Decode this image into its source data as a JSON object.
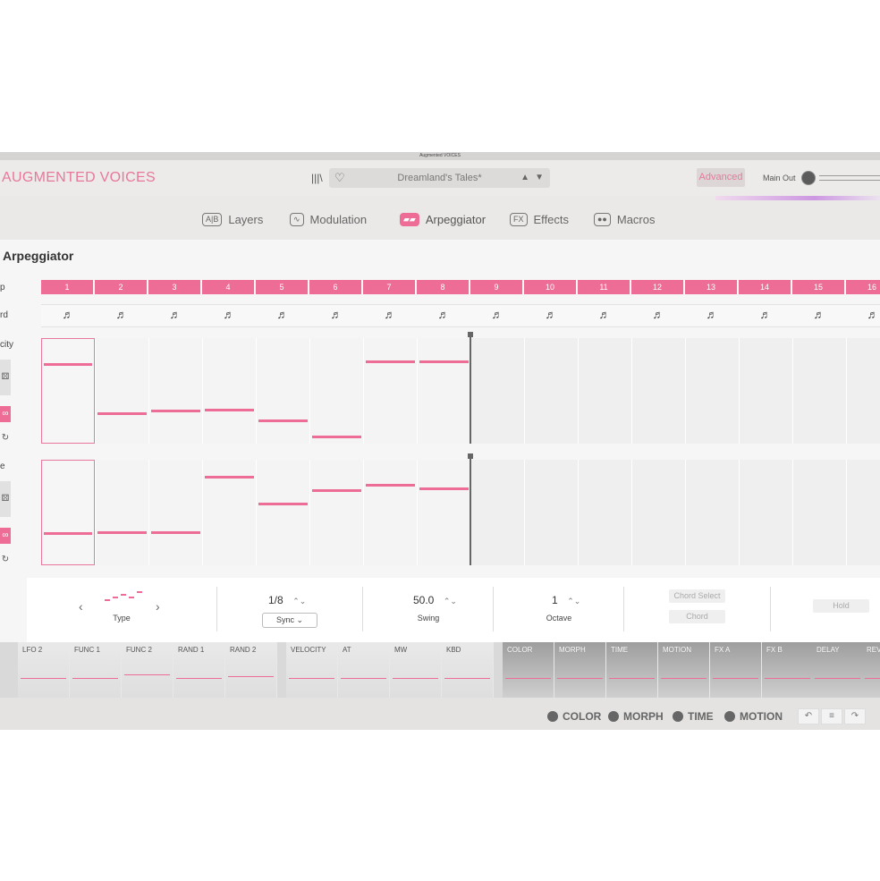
{
  "window_title": "Augmented VOICES",
  "header": {
    "brand": "AUGMENTED VOICES",
    "library_icon": "library-icon",
    "preset_name": "Dreamland's Tales*",
    "prev_icon": "▲",
    "next_icon": "▼",
    "advanced_label": "Advanced",
    "main_out_label": "Main Out"
  },
  "tabs": [
    {
      "badge": "A|B",
      "label": "Layers"
    },
    {
      "badge": "∿",
      "label": "Modulation"
    },
    {
      "badge": "▰▰",
      "label": "Arpeggiator"
    },
    {
      "badge": "FX",
      "label": "Effects"
    },
    {
      "badge": "●●",
      "label": "Macros"
    }
  ],
  "arp": {
    "title": "Arpeggiator",
    "row_labels": {
      "steps": "p",
      "chord": "rd",
      "velocity": "city",
      "gate": "e"
    },
    "steps": [
      "1",
      "2",
      "3",
      "4",
      "5",
      "6",
      "7",
      "8",
      "9",
      "10",
      "11",
      "12",
      "13",
      "14",
      "15",
      "16"
    ],
    "active_steps": 8,
    "note_symbol": "♬",
    "velocity": [
      0.76,
      0.27,
      0.3,
      0.31,
      0.2,
      0.04,
      0.78,
      0.78
    ],
    "gate": [
      0.3,
      0.3,
      0.3,
      0.84,
      0.58,
      0.71,
      0.76,
      0.73
    ]
  },
  "controls": {
    "type_label": "Type",
    "prev": "‹",
    "next": "›",
    "rate_value": "1/8",
    "sync_label": "Sync ⌄",
    "swing_value": "50.0",
    "swing_label": "Swing",
    "octave_value": "1",
    "octave_label": "Octave",
    "chord_select_label": "Chord Select",
    "chord_label": "Chord",
    "hold_label": "Hold",
    "stepper_icon": "⌃⌄"
  },
  "mod_sources": [
    "LFO 2",
    "FUNC 1",
    "FUNC 2",
    "RAND 1",
    "RAND 2",
    "VELOCITY",
    "AT",
    "MW",
    "KBD",
    "COLOR",
    "MORPH",
    "TIME",
    "MOTION",
    "FX A",
    "FX B",
    "DELAY",
    "REV"
  ],
  "footer": {
    "macros": [
      "COLOR",
      "MORPH",
      "TIME",
      "MOTION"
    ],
    "undo_icon": "↶",
    "menu_icon": "≡",
    "redo_icon": "↷"
  },
  "colors": {
    "accent": "#ed6d97",
    "brand": "#e8779b",
    "background": "#ebe9e8"
  }
}
